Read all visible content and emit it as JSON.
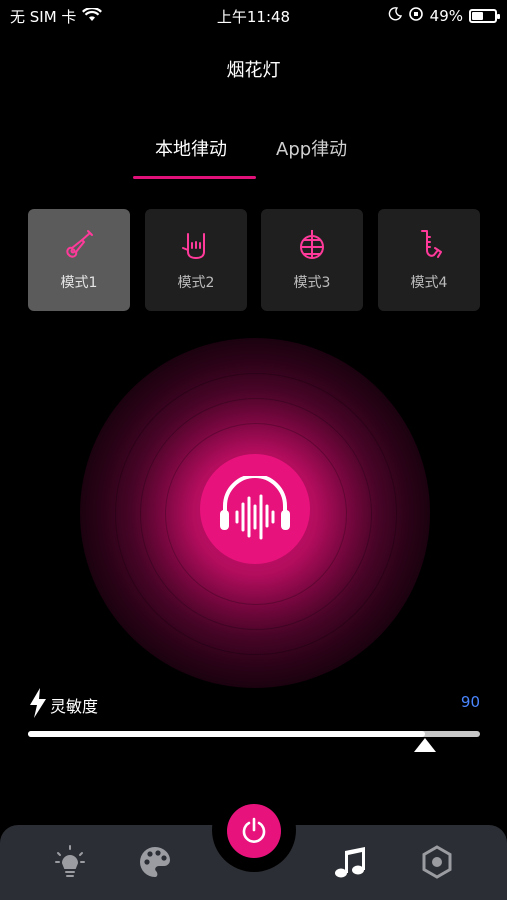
{
  "status_bar": {
    "carrier": "无 SIM 卡",
    "time": "上午11:48",
    "battery_percent_text": "49%",
    "battery_level": 0.49
  },
  "header": {
    "title": "烟花灯"
  },
  "tabs": [
    {
      "label": "本地律动",
      "active": true
    },
    {
      "label": "App律动",
      "active": false
    }
  ],
  "modes": [
    {
      "label": "模式1",
      "icon": "guitar-icon",
      "selected": true
    },
    {
      "label": "模式2",
      "icon": "rock-hand-icon",
      "selected": false
    },
    {
      "label": "模式3",
      "icon": "disco-ball-icon",
      "selected": false
    },
    {
      "label": "模式4",
      "icon": "saxophone-icon",
      "selected": false
    }
  ],
  "center_button": {
    "icon": "headphones-sound-icon"
  },
  "sensitivity": {
    "label": "灵敏度",
    "value_text": "90",
    "value": 90,
    "max": 100,
    "icon": "lightning-icon"
  },
  "bottom_nav": {
    "items": [
      {
        "icon": "lightbulb-icon"
      },
      {
        "icon": "palette-icon"
      },
      {
        "icon": "power-icon"
      },
      {
        "icon": "music-note-icon"
      },
      {
        "icon": "hexagon-settings-icon"
      }
    ]
  },
  "colors": {
    "accent": "#e8127c",
    "value_blue": "#4a86ff",
    "nav_bg": "#2b2e34"
  }
}
